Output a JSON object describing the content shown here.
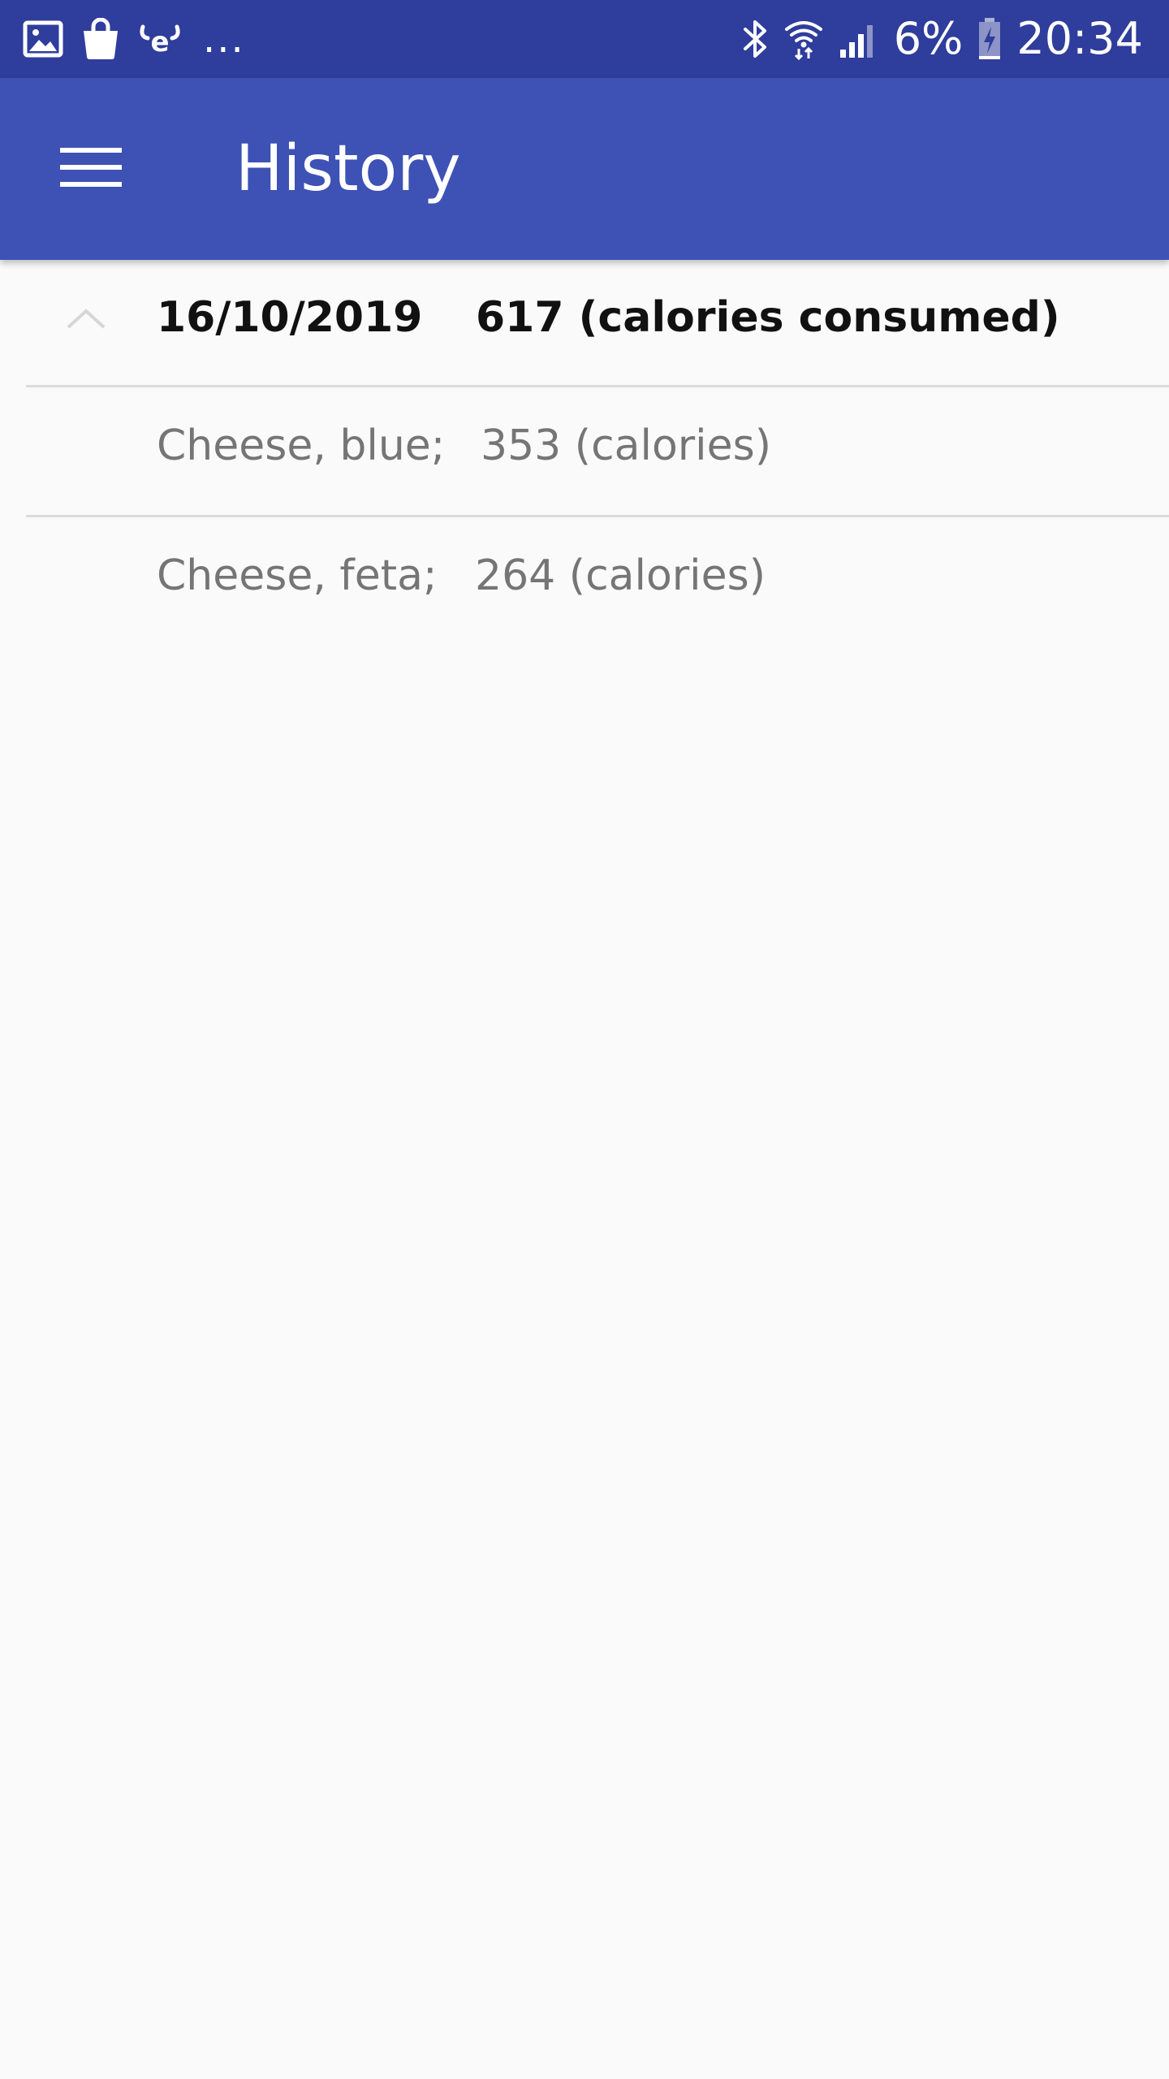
{
  "status_bar": {
    "battery_percent": "6%",
    "time": "20:34",
    "overflow": "...",
    "icons_left": [
      "gallery-icon",
      "shopping-bag-icon",
      "app-e-icon"
    ],
    "icons_right": [
      "bluetooth-icon",
      "wifi-icon",
      "signal-icon",
      "battery-charging-icon"
    ]
  },
  "app_bar": {
    "title": "History",
    "menu_icon": "hamburger-menu-icon",
    "background": "#3e51b5"
  },
  "history": {
    "groups": [
      {
        "date": "16/10/2019",
        "total": "617 (calories consumed)",
        "expanded": true,
        "items": [
          {
            "name": "Cheese, blue;",
            "calories": "353 (calories)"
          },
          {
            "name": "Cheese, feta;",
            "calories": "264 (calories)"
          }
        ]
      }
    ]
  }
}
